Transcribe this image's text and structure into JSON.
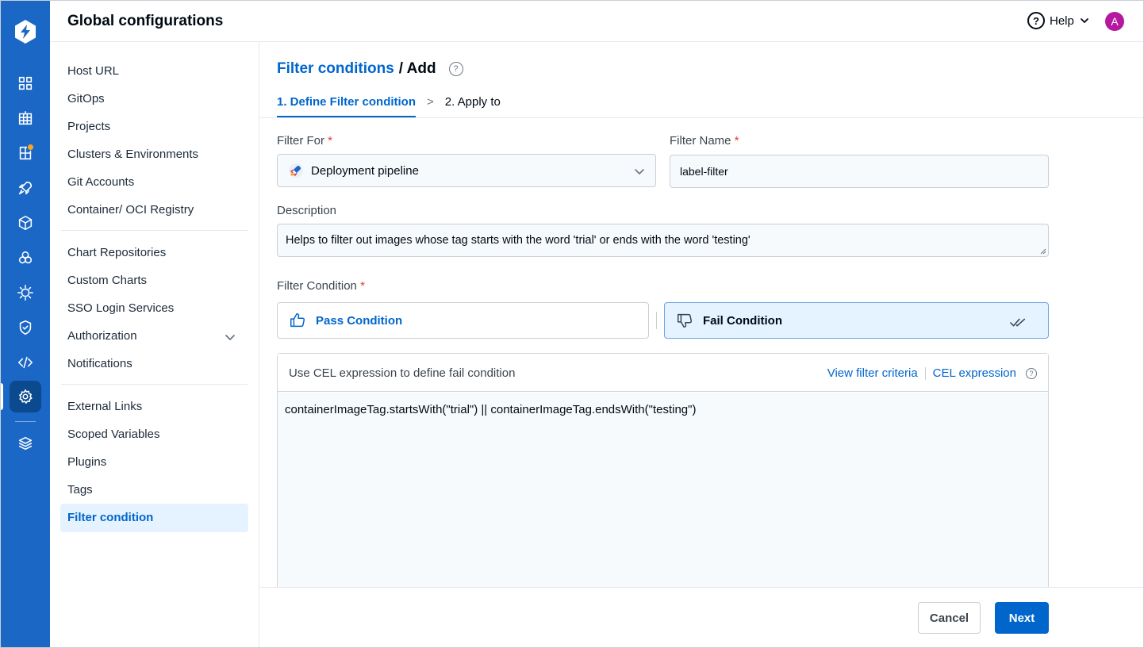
{
  "app": {
    "title": "Global configurations",
    "help_label": "Help",
    "avatar_initial": "A",
    "accent_color": "#0066cc",
    "rail_color": "#1a67c6"
  },
  "rail": {
    "icons": [
      "devtron-logo-icon",
      "app-grid-icon",
      "chart-grid-icon",
      "resource-browser-icon",
      "rocket-icon",
      "cube-icon",
      "bulk-edit-icon",
      "security-bug-icon",
      "shield-icon",
      "code-icon",
      "settings-gear-icon",
      "stack-layers-icon"
    ],
    "active": "settings-gear-icon"
  },
  "nav": {
    "group1": [
      "Host URL",
      "GitOps",
      "Projects",
      "Clusters & Environments",
      "Git Accounts",
      "Container/ OCI Registry"
    ],
    "group2": [
      "Chart Repositories",
      "Custom Charts",
      "SSO Login Services",
      "Authorization",
      "Notifications"
    ],
    "group3": [
      "External Links",
      "Scoped Variables",
      "Plugins",
      "Tags"
    ],
    "selected": "Filter condition"
  },
  "main": {
    "breadcrumb_link": "Filter conditions",
    "breadcrumb_current": "/ Add",
    "tab_1": "1. Define Filter condition",
    "tab_sep": ">",
    "tab_2": "2. Apply to",
    "filter_for_label": "Filter For",
    "filter_for_value": "Deployment pipeline",
    "filter_name_label": "Filter Name",
    "filter_name_value": "label-filter",
    "description_label": "Description",
    "description_value": "Helps to filter out images whose tag starts with the word 'trial' or ends with the word 'testing'",
    "condition_label": "Filter Condition",
    "required_mark": "*",
    "pass_label": "Pass Condition",
    "fail_label": "Fail Condition",
    "selected_condition": "Fail Condition",
    "editor_hint": "Use CEL expression to define fail condition",
    "view_criteria_link": "View filter criteria",
    "cel_link": "CEL expression",
    "expression": "containerImageTag.startsWith(\"trial\") || containerImageTag.endsWith(\"testing\")"
  },
  "footer": {
    "cancel_label": "Cancel",
    "next_label": "Next"
  }
}
